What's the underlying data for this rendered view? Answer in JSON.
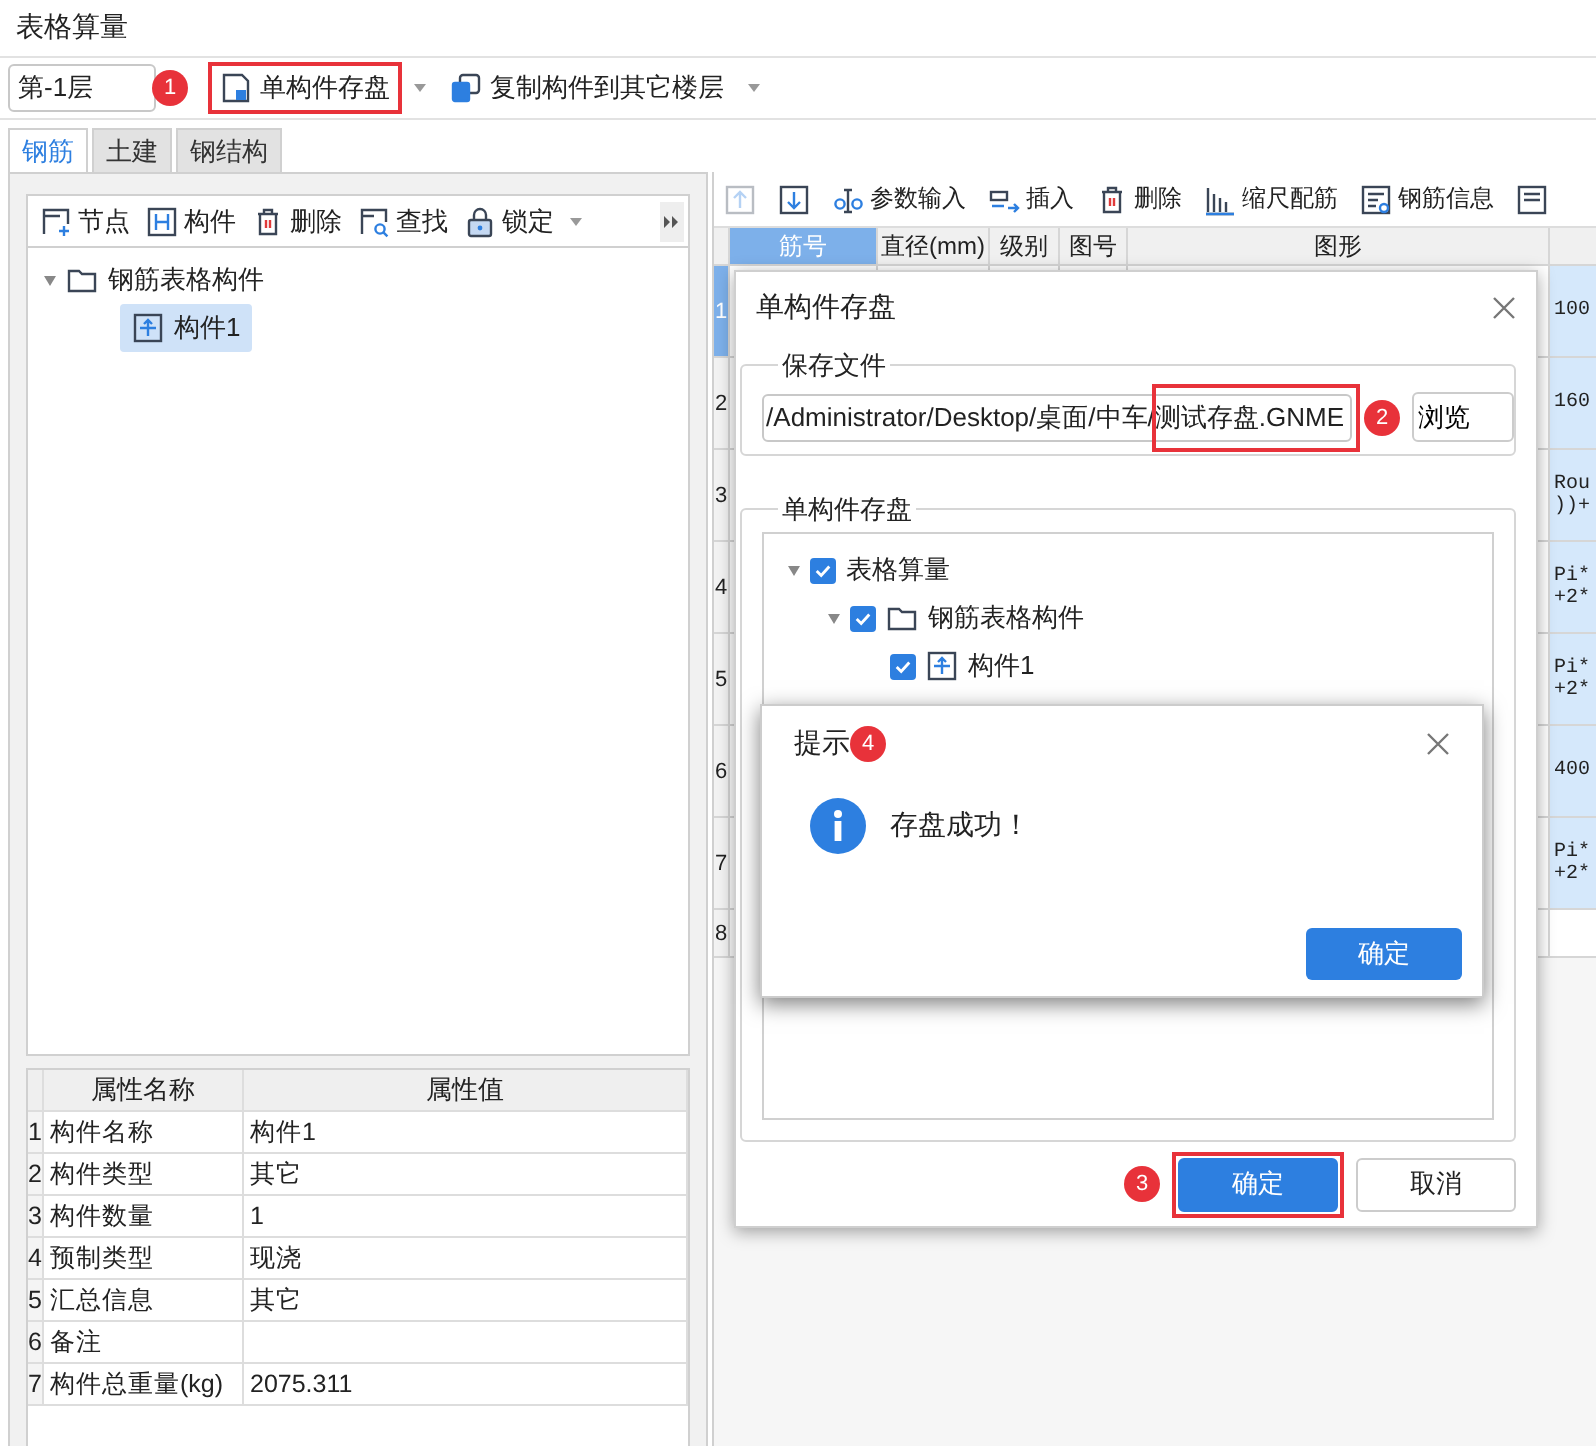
{
  "title": "表格算量",
  "toolbar": {
    "floor": "第-1层",
    "floor_badge": "1",
    "buttons": [
      {
        "label": "单构件存盘",
        "kind": "save",
        "highlighted": true,
        "caret": true
      },
      {
        "label": "复制构件到其它楼层",
        "kind": "copy",
        "highlighted": false,
        "caret": true
      }
    ]
  },
  "tabs": [
    {
      "label": "钢筋",
      "selected": true
    },
    {
      "label": "土建",
      "selected": false
    },
    {
      "label": "钢结构",
      "selected": false
    }
  ],
  "tree_toolbar": [
    {
      "label": "节点",
      "kind": "node",
      "caret": false
    },
    {
      "label": "构件",
      "kind": "part",
      "caret": false
    },
    {
      "label": "删除",
      "kind": "delete",
      "caret": false
    },
    {
      "label": "查找",
      "kind": "find",
      "caret": false
    },
    {
      "label": "锁定",
      "kind": "lock",
      "caret": true
    }
  ],
  "tree": [
    {
      "label": "钢筋表格构件",
      "kind": "folder",
      "expanded": true,
      "selected": false,
      "children": [
        {
          "label": "构件1",
          "kind": "part",
          "selected": true
        }
      ]
    }
  ],
  "properties": {
    "columns": [
      "属性名称",
      "属性值"
    ],
    "rows": [
      {
        "index": "1",
        "name": "构件名称",
        "value": "构件1"
      },
      {
        "index": "2",
        "name": "构件类型",
        "value": "其它"
      },
      {
        "index": "3",
        "name": "构件数量",
        "value": "1"
      },
      {
        "index": "4",
        "name": "预制类型",
        "value": "现浇"
      },
      {
        "index": "5",
        "name": "汇总信息",
        "value": "其它"
      },
      {
        "index": "6",
        "name": "备注"
      },
      {
        "index": "7",
        "name": "构件总重量(kg)",
        "value": "2075.311"
      }
    ]
  },
  "rebar_toolbar": [
    {
      "kind": "up",
      "disabled": true
    },
    {
      "kind": "down",
      "disabled": false
    },
    {
      "kind": "param",
      "label": "参数输入",
      "disabled": false
    },
    {
      "kind": "insert",
      "label": "插入",
      "disabled": false
    },
    {
      "kind": "delete",
      "label": "删除",
      "disabled": false
    },
    {
      "kind": "scale",
      "label": "缩尺配筋",
      "disabled": false
    },
    {
      "kind": "info",
      "label": "钢筋信息",
      "disabled": false
    },
    {
      "kind": "more",
      "disabled": false
    }
  ],
  "rebar_table": {
    "columns": [
      {
        "label": "筋号",
        "selected": true
      },
      {
        "label": "直径(mm)",
        "selected": false
      },
      {
        "label": "级别",
        "selected": false
      },
      {
        "label": "图号",
        "selected": false
      },
      {
        "label": "图形",
        "selected": false
      }
    ],
    "rows": [
      {
        "index": "1",
        "selected": true,
        "column_6": "100"
      },
      {
        "index": "2",
        "selected": false,
        "column_6": "160"
      },
      {
        "index": "3",
        "selected": false,
        "column_6": "Rou\n))+"
      },
      {
        "index": "4",
        "selected": false,
        "column_6": "Pi*\n+2*"
      },
      {
        "index": "5",
        "selected": false,
        "column_6": "Pi*\n+2*"
      },
      {
        "index": "6",
        "selected": false,
        "column_6": "400"
      },
      {
        "index": "7",
        "selected": false,
        "column_6": "Pi*\n+2*"
      },
      {
        "index": "8",
        "selected": false
      }
    ]
  },
  "save_dialog": {
    "title": "单构件存盘",
    "file_group": {
      "title": "保存文件",
      "path": "/Administrator/Desktop/桌面/中车/测试存盘.GNME",
      "path_highlighted": true,
      "badge": "2",
      "browse": "浏览"
    },
    "tree_group": {
      "title": "单构件存盘",
      "tree": [
        {
          "label": "表格算量",
          "checked": true,
          "expanded": true,
          "children": [
            {
              "label": "钢筋表格构件",
              "kind": "folder",
              "checked": true,
              "expanded": true,
              "children": [
                {
                  "label": "构件1",
                  "kind": "part",
                  "checked": true
                }
              ]
            }
          ]
        }
      ]
    },
    "buttons": [
      {
        "label": "确定",
        "primary": true,
        "highlighted": true,
        "badge": "3"
      },
      {
        "label": "取消",
        "primary": false,
        "highlighted": false
      }
    ]
  },
  "message_box": {
    "title": "提示",
    "badge": "4",
    "message": "存盘成功！",
    "button": "确定"
  }
}
